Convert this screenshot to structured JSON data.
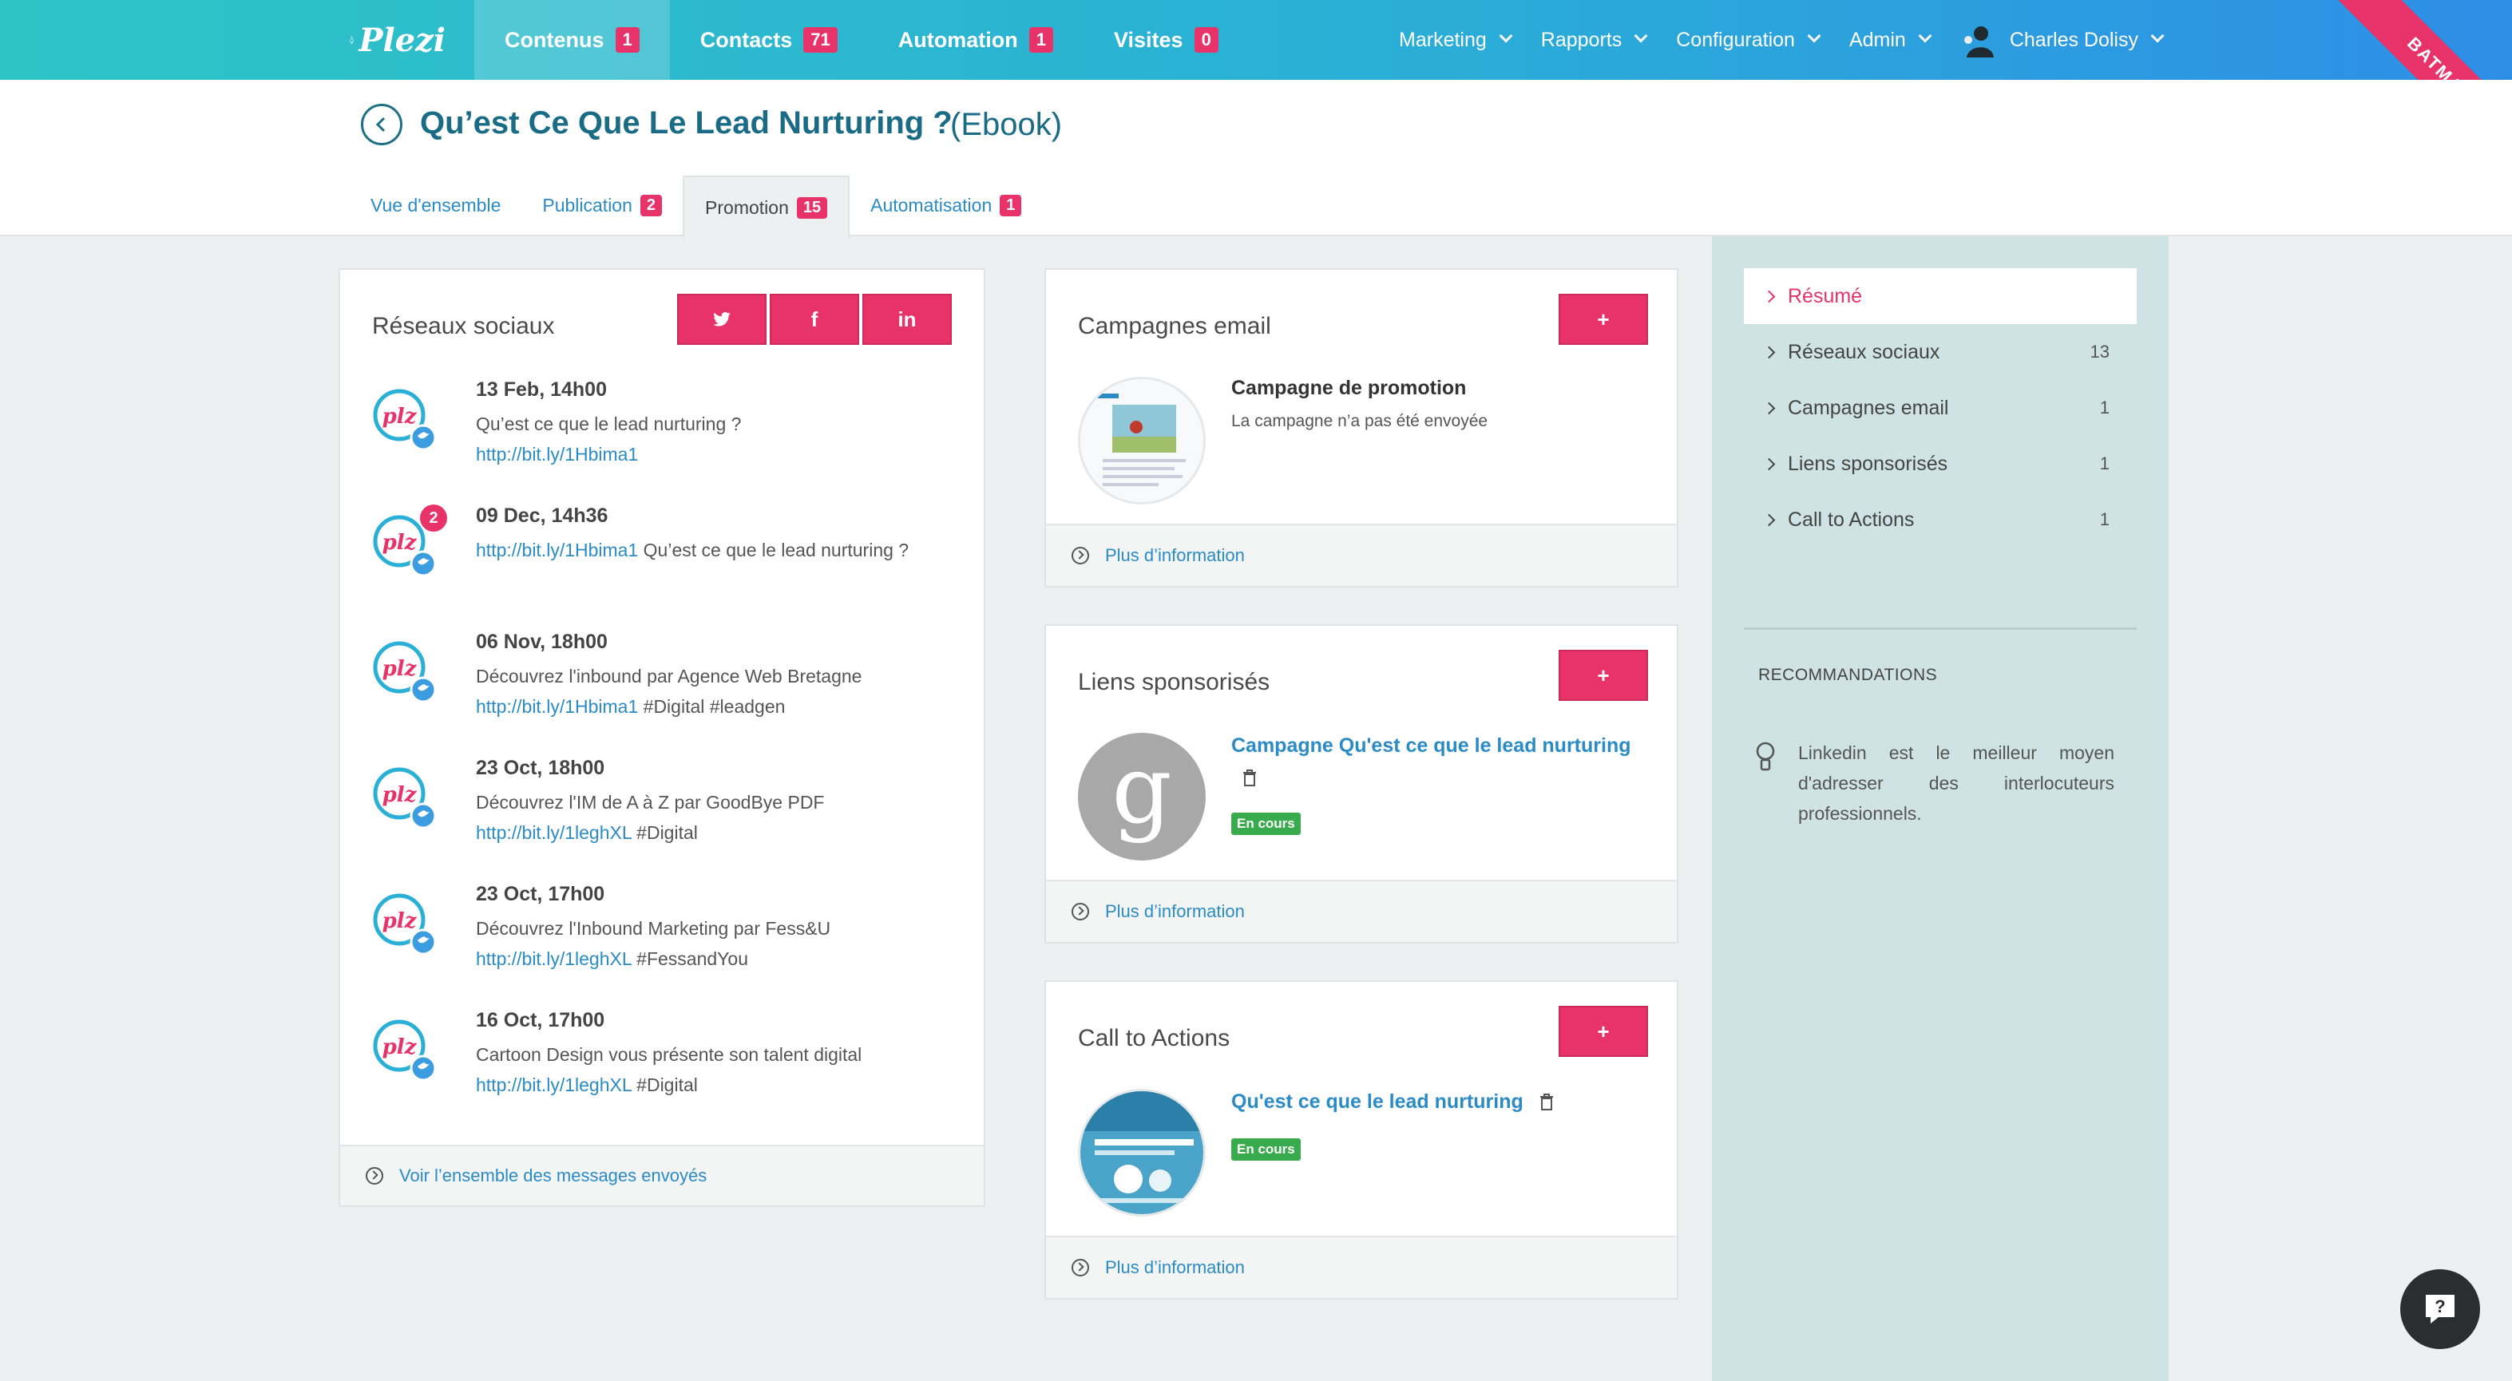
{
  "nav": {
    "logo": "Plezi",
    "items": [
      {
        "label": "Contenus",
        "badge": "1"
      },
      {
        "label": "Contacts",
        "badge": "71"
      },
      {
        "label": "Automation",
        "badge": "1"
      },
      {
        "label": "Visites",
        "badge": "0"
      }
    ],
    "menus": [
      "Marketing",
      "Rapports",
      "Configuration",
      "Admin"
    ],
    "user": "Charles Dolisy",
    "ribbon": "BATMAN"
  },
  "header": {
    "title": "Qu’est Ce Que Le Lead Nurturing ?",
    "type": "(Ebook)",
    "tabs": [
      {
        "label": "Vue d'ensemble",
        "badge": ""
      },
      {
        "label": "Publication",
        "badge": "2"
      },
      {
        "label": "Promotion",
        "badge": "15"
      },
      {
        "label": "Automatisation",
        "badge": "1"
      }
    ]
  },
  "social": {
    "title": "Réseaux sociaux",
    "buttons": {
      "twitter": "🐦",
      "facebook": "f",
      "linkedin": "in"
    },
    "posts": [
      {
        "date": "13 Feb, 14h00",
        "text_before": "Qu’est ce que le lead nurturing ?",
        "link": "http://bit.ly/1Hbima1",
        "text_after": "",
        "notif": ""
      },
      {
        "date": "09 Dec, 14h36",
        "text_before": "",
        "link": "http://bit.ly/1Hbima1",
        "text_after": " Qu’est ce que le lead nurturing ?",
        "notif": "2"
      },
      {
        "date": "06 Nov, 18h00",
        "text_before": "Découvrez l'inbound par Agence Web Bretagne",
        "link": "http://bit.ly/1Hbima1",
        "text_after": " #Digital #leadgen",
        "notif": ""
      },
      {
        "date": "23 Oct, 18h00",
        "text_before": "Découvrez l'IM de A à Z par GoodBye PDF",
        "link": "http://bit.ly/1leghXL",
        "text_after": " #Digital",
        "notif": ""
      },
      {
        "date": "23 Oct, 17h00",
        "text_before": "Découvrez l'Inbound Marketing par Fess&U",
        "link": "http://bit.ly/1leghXL",
        "text_after": " #FessandYou",
        "notif": ""
      },
      {
        "date": "16 Oct, 17h00",
        "text_before": "Cartoon Design vous présente son talent digital",
        "link": "http://bit.ly/1leghXL",
        "text_after": " #Digital",
        "notif": ""
      }
    ],
    "footer": "Voir l’ensemble des messages envoyés"
  },
  "email": {
    "title": "Campagnes email",
    "add": "+",
    "item_title": "Campagne de promotion",
    "item_sub": "La campagne n’a pas été envoyée",
    "footer": "Plus d’information"
  },
  "sponsored": {
    "title": "Liens sponsorisés",
    "add": "+",
    "item_title": "Campagne Qu'est ce que le lead nurturing",
    "status": "En cours",
    "logo_letter": "g",
    "footer": "Plus d’information"
  },
  "cta": {
    "title": "Call to Actions",
    "add": "+",
    "item_title": "Qu'est ce que le lead nurturing",
    "status": "En cours",
    "footer": "Plus d’information"
  },
  "sidebar": {
    "items": [
      {
        "label": "Résumé",
        "count": ""
      },
      {
        "label": "Réseaux sociaux",
        "count": "13"
      },
      {
        "label": "Campagnes email",
        "count": "1"
      },
      {
        "label": "Liens sponsorisés",
        "count": "1"
      },
      {
        "label": "Call to Actions",
        "count": "1"
      }
    ],
    "rec_title": "RECOMMANDATIONS",
    "rec_text": "Linkedin est le meilleur moyen d'adresser des interlocuteurs professionnels."
  },
  "colors": {
    "accent": "#e8336a",
    "link": "#2a8bc6",
    "title": "#1a6b86",
    "success": "#3aab4c"
  }
}
